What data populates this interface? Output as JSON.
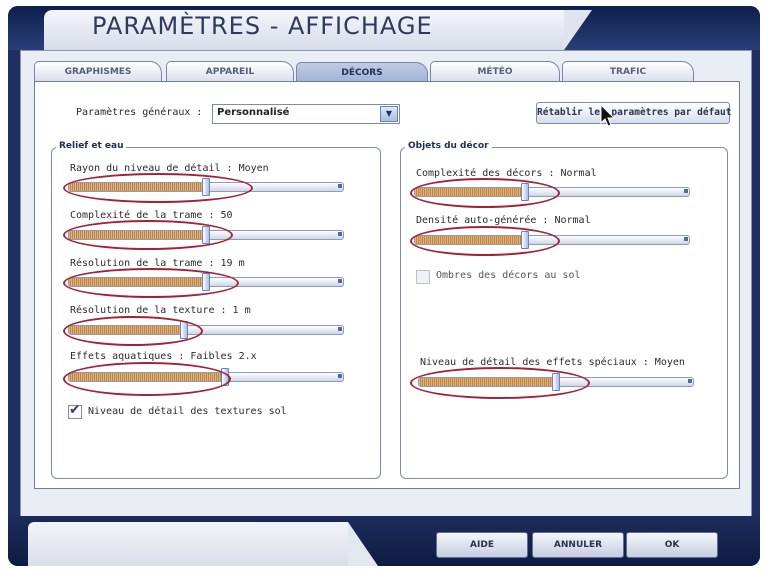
{
  "window": {
    "title": "PARAMÈTRES - AFFICHAGE"
  },
  "tabs": [
    {
      "label": "GRAPHISMES",
      "active": false
    },
    {
      "label": "APPAREIL",
      "active": false
    },
    {
      "label": "DÉCORS",
      "active": true
    },
    {
      "label": "MÉTÉO",
      "active": false
    },
    {
      "label": "TRAFIC",
      "active": false
    }
  ],
  "general": {
    "label": "Paramètres généraux :",
    "value": "Personnalisé",
    "reset_label": "Rétablir les paramètres par défaut"
  },
  "relief": {
    "title": "Relief et eau",
    "sliders": [
      {
        "label": "Rayon du niveau de détail : Moyen",
        "level": 0.5
      },
      {
        "label": "Complexité de la trame : 50",
        "level": 0.5
      },
      {
        "label": "Résolution de la trame : 19 m",
        "level": 0.5
      },
      {
        "label": "Résolution de la texture : 1 m",
        "level": 0.42
      },
      {
        "label": "Effets aquatiques : Faibles 2.x",
        "level": 0.57
      }
    ],
    "checkbox": {
      "label": "Niveau de détail des textures sol",
      "checked": true
    }
  },
  "objects": {
    "title": "Objets du décor",
    "sliders": [
      {
        "label": "Complexité des décors : Normal",
        "level": 0.4
      },
      {
        "label": "Densité auto-générée : Normal",
        "level": 0.4
      },
      {
        "label": "Niveau de détail des effets spéciaux : Moyen",
        "level": 0.5
      }
    ],
    "checkbox": {
      "label": "Ombres des décors au sol",
      "checked": false
    }
  },
  "buttons": {
    "help": "AIDE",
    "cancel": "ANNULER",
    "ok": "OK"
  },
  "colors": {
    "frame": "#1d2f63",
    "highlight_oval": "#a0233a",
    "slider_fill": "#c99357"
  }
}
